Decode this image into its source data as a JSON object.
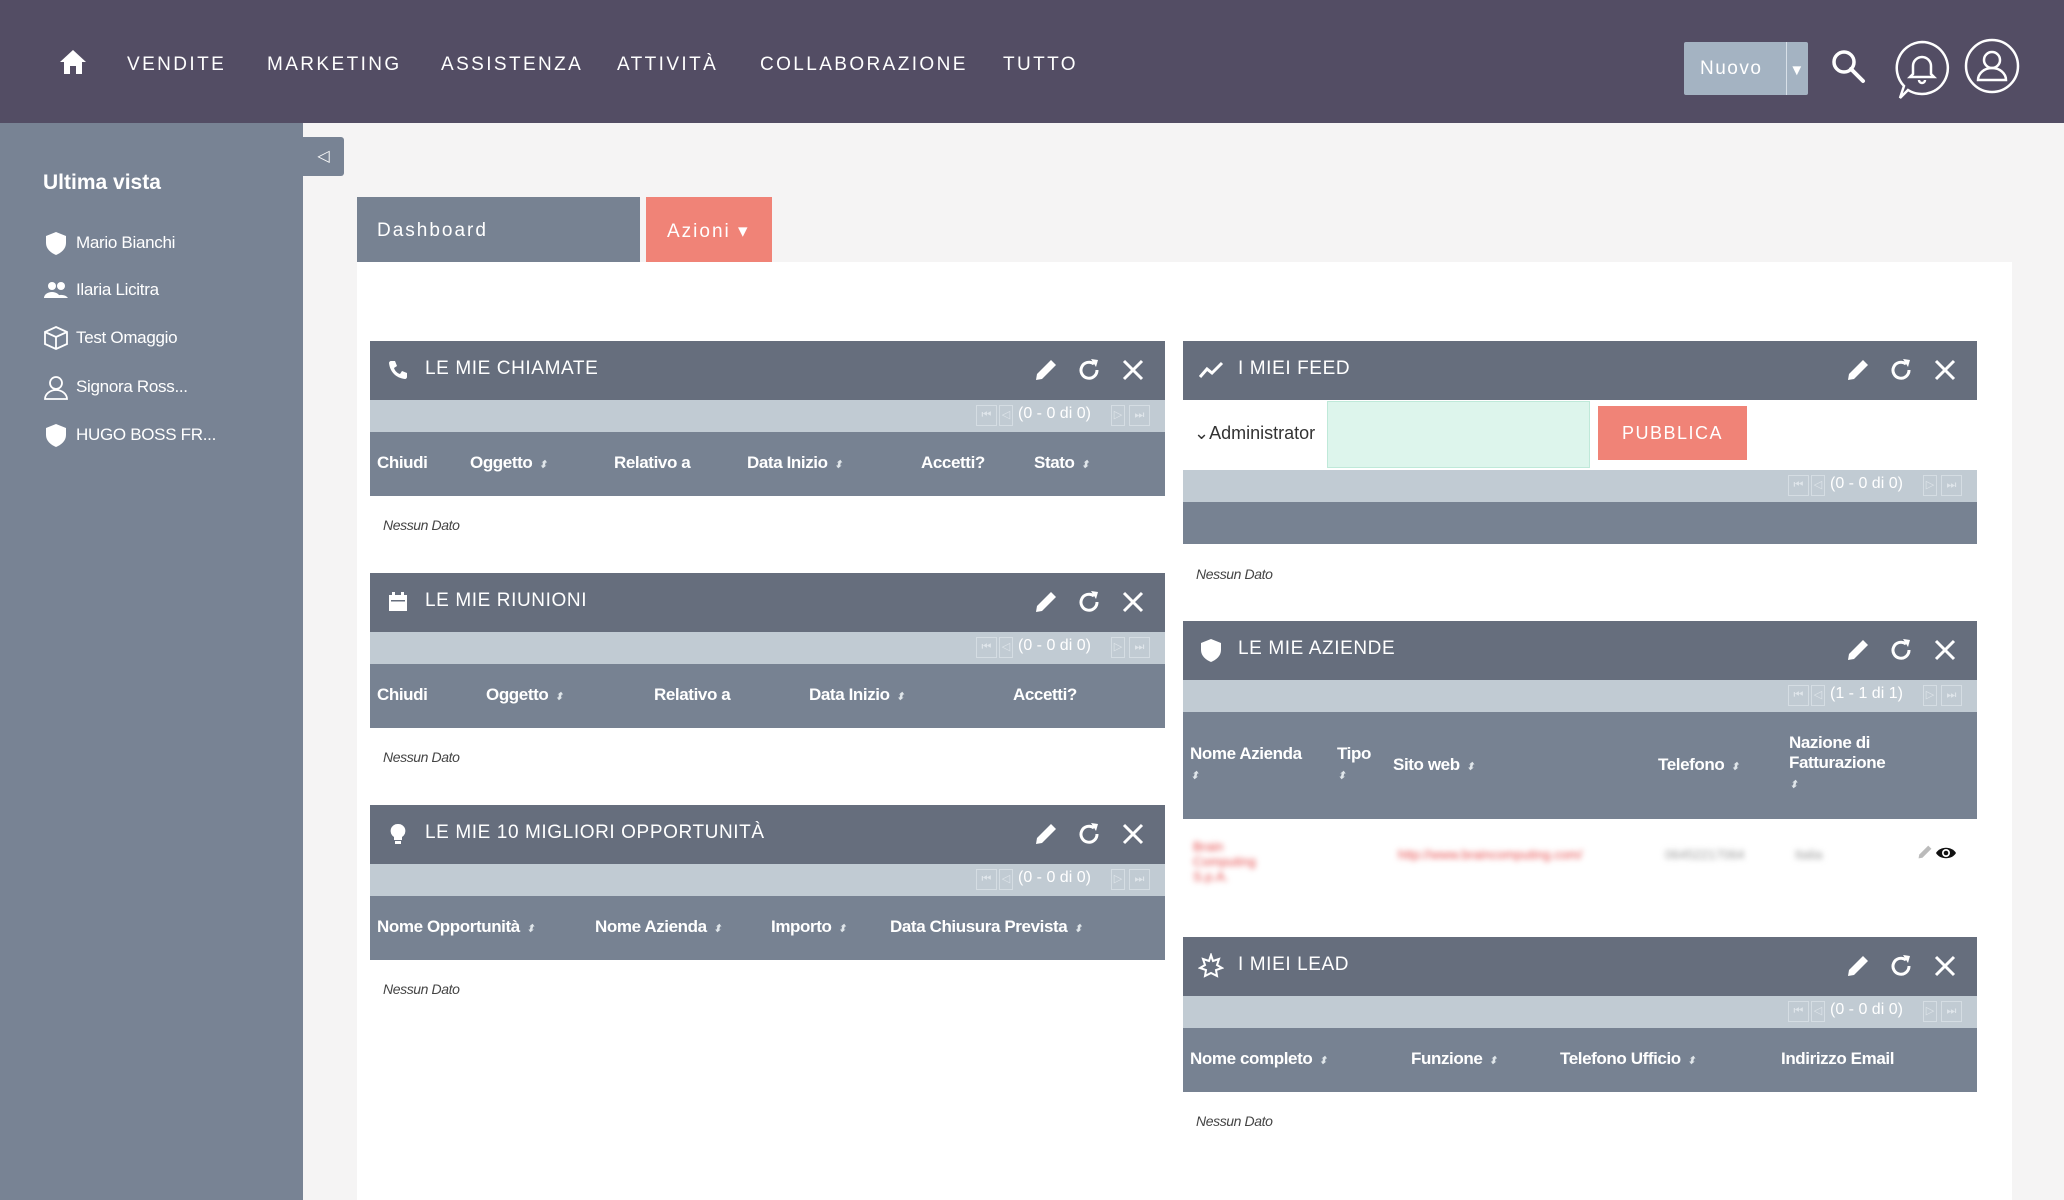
{
  "nav": {
    "items": [
      "VENDITE",
      "MARKETING",
      "ASSISTENZA",
      "ATTIVITÀ",
      "COLLABORAZIONE",
      "TUTTO"
    ],
    "new_button": "Nuovo"
  },
  "sidebar": {
    "title": "Ultima vista",
    "items": [
      {
        "label": "Mario Bianchi",
        "icon": "shield-icon"
      },
      {
        "label": "Ilaria Licitra",
        "icon": "users-icon"
      },
      {
        "label": "Test Omaggio",
        "icon": "box-icon"
      },
      {
        "label": "Signora Ross...",
        "icon": "user-icon"
      },
      {
        "label": "HUGO BOSS FR...",
        "icon": "shield-icon"
      }
    ]
  },
  "tabs": {
    "dashboard": "Dashboard",
    "actions": "Azioni ▾"
  },
  "no_data": "Nessun Dato",
  "dashlets": {
    "calls": {
      "title": "LE MIE CHIAMATE",
      "count": "(0 - 0 di 0)",
      "columns": [
        "Chiudi",
        "Oggetto",
        "Relativo a",
        "Data Inizio",
        "Accetti?",
        "Stato"
      ]
    },
    "meetings": {
      "title": "LE MIE RIUNIONI",
      "count": "(0 - 0 di 0)",
      "columns": [
        "Chiudi",
        "Oggetto",
        "Relativo a",
        "Data Inizio",
        "Accetti?"
      ]
    },
    "opportunities": {
      "title": "LE MIE 10 MIGLIORI OPPORTUNITÀ",
      "count": "(0 - 0 di 0)",
      "columns": [
        "Nome Opportunità",
        "Nome Azienda",
        "Importo",
        "Data Chiusura Prevista"
      ]
    },
    "feed": {
      "title": "I MIEI FEED",
      "user": "Administrator",
      "publish": "PUBBLICA",
      "count": "(0 - 0 di 0)"
    },
    "companies": {
      "title": "LE MIE AZIENDE",
      "count": "(1 - 1 di 1)",
      "columns": [
        "Nome Azienda",
        "Tipo",
        "Sito web",
        "Telefono",
        "Nazione di Fatturazione"
      ],
      "row": {
        "name": "Brain Computing S.p.A.",
        "website": "http://www.braincomputing.com/",
        "phone": "06452217064",
        "country": "Italia"
      }
    },
    "leads": {
      "title": "I MIEI LEAD",
      "count": "(0 - 0 di 0)",
      "columns": [
        "Nome completo",
        "Funzione",
        "Telefono Ufficio",
        "Indirizzo Email"
      ]
    }
  },
  "colors": {
    "topbar": "#534d64",
    "sidebar": "#788394",
    "header": "#666e7d",
    "accent": "#f08377"
  }
}
